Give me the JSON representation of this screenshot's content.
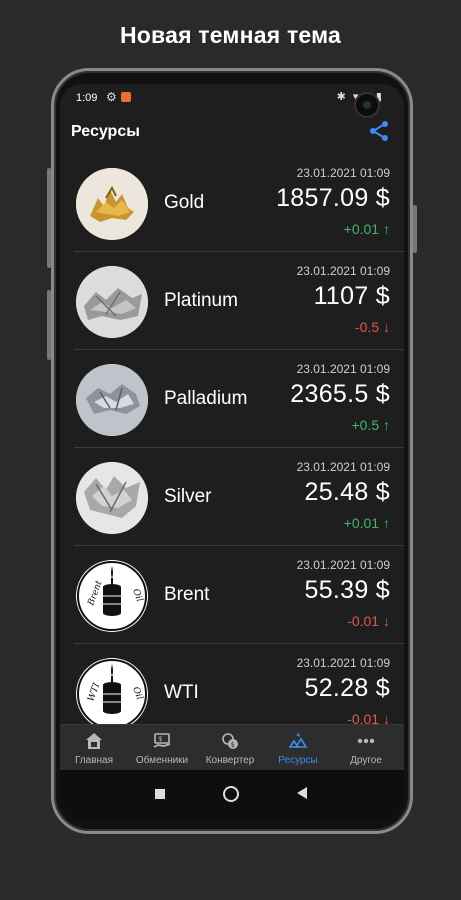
{
  "promo": {
    "title": "Новая темная тема"
  },
  "status_bar": {
    "time": "1:09",
    "icons": "✱ ▾◢ ▮"
  },
  "app_bar": {
    "title": "Ресурсы"
  },
  "items": [
    {
      "name": "Gold",
      "date": "23.01.2021 01:09",
      "price": "1857.09 $",
      "change": "+0.01 ↑",
      "direction": "up"
    },
    {
      "name": "Platinum",
      "date": "23.01.2021 01:09",
      "price": "1107 $",
      "change": "-0.5 ↓",
      "direction": "down"
    },
    {
      "name": "Palladium",
      "date": "23.01.2021 01:09",
      "price": "2365.5 $",
      "change": "+0.5 ↑",
      "direction": "up"
    },
    {
      "name": "Silver",
      "date": "23.01.2021 01:09",
      "price": "25.48 $",
      "change": "+0.01 ↑",
      "direction": "up"
    },
    {
      "name": "Brent",
      "date": "23.01.2021 01:09",
      "price": "55.39 $",
      "change": "-0.01 ↓",
      "direction": "down",
      "logo_text": "Brent Oil"
    },
    {
      "name": "WTI",
      "date": "23.01.2021 01:09",
      "price": "52.28 $",
      "change": "-0.01 ↓",
      "direction": "down",
      "logo_text": "WTI Oil"
    }
  ],
  "bottom_nav": [
    {
      "label": "Главная",
      "icon": "home-icon",
      "active": false
    },
    {
      "label": "Обменники",
      "icon": "exchange-icon",
      "active": false
    },
    {
      "label": "Конвертер",
      "icon": "converter-icon",
      "active": false
    },
    {
      "label": "Ресурсы",
      "icon": "resources-icon",
      "active": true
    },
    {
      "label": "Другое",
      "icon": "more-icon",
      "active": false
    }
  ],
  "colors": {
    "accent": "#3d8bf2",
    "up": "#43b36e",
    "down": "#e05656",
    "background": "#1e1e1e"
  }
}
